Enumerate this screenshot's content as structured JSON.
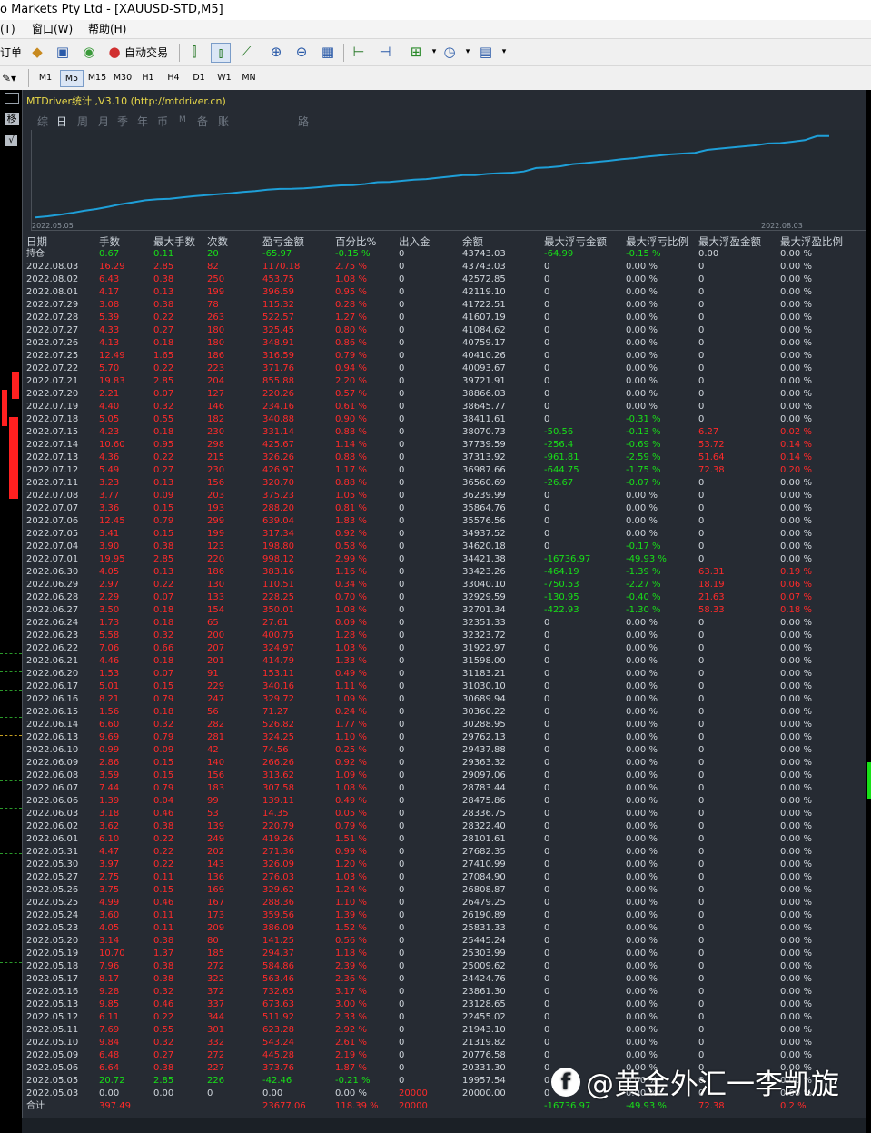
{
  "window": {
    "title": "o Markets Pty Ltd - [XAUUSD-STD,M5]"
  },
  "menu": [
    "(T)",
    "窗口(W)",
    "帮助(H)"
  ],
  "toolbar": {
    "order_label": "订单",
    "auto_trade_label": "自动交易",
    "icons": [
      "bars-icon",
      "candles-icon",
      "line-chart-icon",
      "zoom-in-icon",
      "zoom-out-icon",
      "tile-icon",
      "shift-icon",
      "autoscroll-icon",
      "indicators-icon",
      "clock-icon",
      "templates-icon"
    ]
  },
  "timeframes": [
    "M1",
    "M5",
    "M15",
    "M30",
    "H1",
    "H4",
    "D1",
    "W1",
    "MN"
  ],
  "active_timeframe": "M5",
  "side_labels": [
    "移",
    "√"
  ],
  "panel": {
    "title": "MTDriver统计 ,V3.10 (http://mtdriver.cn)",
    "tabs": [
      "综",
      "日",
      "周",
      "月",
      "季",
      "年",
      "币",
      "M",
      "备",
      "账户",
      "路径"
    ],
    "active_tab": "日"
  },
  "chart_data": {
    "type": "line",
    "x_start_label": "2022.05.05",
    "x_end_label": "2022.08.03",
    "values": [
      20000.0,
      20331.3,
      20776.58,
      21319.82,
      21943.1,
      22455.02,
      23128.65,
      23861.3,
      24424.76,
      25009.62,
      25303.99,
      25445.24,
      25831.33,
      26190.89,
      26479.25,
      26808.87,
      27084.9,
      27410.99,
      27682.35,
      28101.61,
      28322.4,
      28336.75,
      28475.86,
      28783.44,
      29097.06,
      29363.32,
      29437.88,
      29762.13,
      30288.95,
      30360.22,
      30689.94,
      31030.1,
      31183.21,
      31598.0,
      31922.97,
      32323.72,
      32351.33,
      32701.34,
      32929.59,
      33040.1,
      33423.26,
      34421.38,
      34620.18,
      34937.52,
      35576.56,
      35864.76,
      36239.99,
      36560.69,
      36987.66,
      37313.92,
      37739.59,
      38070.73,
      38411.61,
      38645.77,
      38866.03,
      39721.91,
      40093.67,
      40410.26,
      40759.17,
      41084.62,
      41607.19,
      41722.51,
      42119.1,
      42572.85,
      43743.02,
      43743.03
    ],
    "ylim": [
      19000,
      44500
    ],
    "color": "#1e9fd8"
  },
  "table": {
    "headers": [
      "日期",
      "手数",
      "最大手数",
      "次数",
      "盈亏金额",
      "百分比%",
      "出入金",
      "余额",
      "最大浮亏金额",
      "最大浮亏比例",
      "最大浮盈金额",
      "最大浮盈比例"
    ],
    "hold_row": [
      "持仓",
      "0.67",
      "0.11",
      "20",
      "-65.97",
      "-0.15 %",
      "0",
      "43743.03",
      "-64.99",
      "-0.15 %",
      "0.00",
      "0.00 %"
    ],
    "rows": [
      [
        "2022.08.03",
        "16.29",
        "2.85",
        "82",
        "1170.18",
        "2.75 %",
        "0",
        "43743.03",
        "0",
        "0.00 %",
        "0",
        "0.00 %"
      ],
      [
        "2022.08.02",
        "6.43",
        "0.38",
        "250",
        "453.75",
        "1.08 %",
        "0",
        "42572.85",
        "0",
        "0.00 %",
        "0",
        "0.00 %"
      ],
      [
        "2022.08.01",
        "4.17",
        "0.13",
        "199",
        "396.59",
        "0.95 %",
        "0",
        "42119.10",
        "0",
        "0.00 %",
        "0",
        "0.00 %"
      ],
      [
        "2022.07.29",
        "3.08",
        "0.38",
        "78",
        "115.32",
        "0.28 %",
        "0",
        "41722.51",
        "0",
        "0.00 %",
        "0",
        "0.00 %"
      ],
      [
        "2022.07.28",
        "5.39",
        "0.22",
        "263",
        "522.57",
        "1.27 %",
        "0",
        "41607.19",
        "0",
        "0.00 %",
        "0",
        "0.00 %"
      ],
      [
        "2022.07.27",
        "4.33",
        "0.27",
        "180",
        "325.45",
        "0.80 %",
        "0",
        "41084.62",
        "0",
        "0.00 %",
        "0",
        "0.00 %"
      ],
      [
        "2022.07.26",
        "4.13",
        "0.18",
        "180",
        "348.91",
        "0.86 %",
        "0",
        "40759.17",
        "0",
        "0.00 %",
        "0",
        "0.00 %"
      ],
      [
        "2022.07.25",
        "12.49",
        "1.65",
        "186",
        "316.59",
        "0.79 %",
        "0",
        "40410.26",
        "0",
        "0.00 %",
        "0",
        "0.00 %"
      ],
      [
        "2022.07.22",
        "5.70",
        "0.22",
        "223",
        "371.76",
        "0.94 %",
        "0",
        "40093.67",
        "0",
        "0.00 %",
        "0",
        "0.00 %"
      ],
      [
        "2022.07.21",
        "19.83",
        "2.85",
        "204",
        "855.88",
        "2.20 %",
        "0",
        "39721.91",
        "0",
        "0.00 %",
        "0",
        "0.00 %"
      ],
      [
        "2022.07.20",
        "2.21",
        "0.07",
        "127",
        "220.26",
        "0.57 %",
        "0",
        "38866.03",
        "0",
        "0.00 %",
        "0",
        "0.00 %"
      ],
      [
        "2022.07.19",
        "4.40",
        "0.32",
        "146",
        "234.16",
        "0.61 %",
        "0",
        "38645.77",
        "0",
        "0.00 %",
        "0",
        "0.00 %"
      ],
      [
        "2022.07.18",
        "5.05",
        "0.55",
        "182",
        "340.88",
        "0.90 %",
        "0",
        "38411.61",
        "0",
        "-0.31 %",
        "0",
        "0.00 %"
      ],
      [
        "2022.07.15",
        "4.23",
        "0.18",
        "230",
        "331.14",
        "0.88 %",
        "0",
        "38070.73",
        "-50.56",
        "-0.13 %",
        "6.27",
        "0.02 %"
      ],
      [
        "2022.07.14",
        "10.60",
        "0.95",
        "298",
        "425.67",
        "1.14 %",
        "0",
        "37739.59",
        "-256.4",
        "-0.69 %",
        "53.72",
        "0.14 %"
      ],
      [
        "2022.07.13",
        "4.36",
        "0.22",
        "215",
        "326.26",
        "0.88 %",
        "0",
        "37313.92",
        "-961.81",
        "-2.59 %",
        "51.64",
        "0.14 %"
      ],
      [
        "2022.07.12",
        "5.49",
        "0.27",
        "230",
        "426.97",
        "1.17 %",
        "0",
        "36987.66",
        "-644.75",
        "-1.75 %",
        "72.38",
        "0.20 %"
      ],
      [
        "2022.07.11",
        "3.23",
        "0.13",
        "156",
        "320.70",
        "0.88 %",
        "0",
        "36560.69",
        "-26.67",
        "-0.07 %",
        "0",
        "0.00 %"
      ],
      [
        "2022.07.08",
        "3.77",
        "0.09",
        "203",
        "375.23",
        "1.05 %",
        "0",
        "36239.99",
        "0",
        "0.00 %",
        "0",
        "0.00 %"
      ],
      [
        "2022.07.07",
        "3.36",
        "0.15",
        "193",
        "288.20",
        "0.81 %",
        "0",
        "35864.76",
        "0",
        "0.00 %",
        "0",
        "0.00 %"
      ],
      [
        "2022.07.06",
        "12.45",
        "0.79",
        "299",
        "639.04",
        "1.83 %",
        "0",
        "35576.56",
        "0",
        "0.00 %",
        "0",
        "0.00 %"
      ],
      [
        "2022.07.05",
        "3.41",
        "0.15",
        "199",
        "317.34",
        "0.92 %",
        "0",
        "34937.52",
        "0",
        "0.00 %",
        "0",
        "0.00 %"
      ],
      [
        "2022.07.04",
        "3.90",
        "0.38",
        "123",
        "198.80",
        "0.58 %",
        "0",
        "34620.18",
        "0",
        "-0.17 %",
        "0",
        "0.00 %"
      ],
      [
        "2022.07.01",
        "19.95",
        "2.85",
        "220",
        "998.12",
        "2.99 %",
        "0",
        "34421.38",
        "-16736.97",
        "-49.93 %",
        "0",
        "0.00 %"
      ],
      [
        "2022.06.30",
        "4.05",
        "0.13",
        "186",
        "383.16",
        "1.16 %",
        "0",
        "33423.26",
        "-464.19",
        "-1.39 %",
        "63.31",
        "0.19 %"
      ],
      [
        "2022.06.29",
        "2.97",
        "0.22",
        "130",
        "110.51",
        "0.34 %",
        "0",
        "33040.10",
        "-750.53",
        "-2.27 %",
        "18.19",
        "0.06 %"
      ],
      [
        "2022.06.28",
        "2.29",
        "0.07",
        "133",
        "228.25",
        "0.70 %",
        "0",
        "32929.59",
        "-130.95",
        "-0.40 %",
        "21.63",
        "0.07 %"
      ],
      [
        "2022.06.27",
        "3.50",
        "0.18",
        "154",
        "350.01",
        "1.08 %",
        "0",
        "32701.34",
        "-422.93",
        "-1.30 %",
        "58.33",
        "0.18 %"
      ],
      [
        "2022.06.24",
        "1.73",
        "0.18",
        "65",
        "27.61",
        "0.09 %",
        "0",
        "32351.33",
        "0",
        "0.00 %",
        "0",
        "0.00 %"
      ],
      [
        "2022.06.23",
        "5.58",
        "0.32",
        "200",
        "400.75",
        "1.28 %",
        "0",
        "32323.72",
        "0",
        "0.00 %",
        "0",
        "0.00 %"
      ],
      [
        "2022.06.22",
        "7.06",
        "0.66",
        "207",
        "324.97",
        "1.03 %",
        "0",
        "31922.97",
        "0",
        "0.00 %",
        "0",
        "0.00 %"
      ],
      [
        "2022.06.21",
        "4.46",
        "0.18",
        "201",
        "414.79",
        "1.33 %",
        "0",
        "31598.00",
        "0",
        "0.00 %",
        "0",
        "0.00 %"
      ],
      [
        "2022.06.20",
        "1.53",
        "0.07",
        "91",
        "153.11",
        "0.49 %",
        "0",
        "31183.21",
        "0",
        "0.00 %",
        "0",
        "0.00 %"
      ],
      [
        "2022.06.17",
        "5.01",
        "0.15",
        "229",
        "340.16",
        "1.11 %",
        "0",
        "31030.10",
        "0",
        "0.00 %",
        "0",
        "0.00 %"
      ],
      [
        "2022.06.16",
        "8.21",
        "0.79",
        "247",
        "329.72",
        "1.09 %",
        "0",
        "30689.94",
        "0",
        "0.00 %",
        "0",
        "0.00 %"
      ],
      [
        "2022.06.15",
        "1.56",
        "0.18",
        "56",
        "71.27",
        "0.24 %",
        "0",
        "30360.22",
        "0",
        "0.00 %",
        "0",
        "0.00 %"
      ],
      [
        "2022.06.14",
        "6.60",
        "0.32",
        "282",
        "526.82",
        "1.77 %",
        "0",
        "30288.95",
        "0",
        "0.00 %",
        "0",
        "0.00 %"
      ],
      [
        "2022.06.13",
        "9.69",
        "0.79",
        "281",
        "324.25",
        "1.10 %",
        "0",
        "29762.13",
        "0",
        "0.00 %",
        "0",
        "0.00 %"
      ],
      [
        "2022.06.10",
        "0.99",
        "0.09",
        "42",
        "74.56",
        "0.25 %",
        "0",
        "29437.88",
        "0",
        "0.00 %",
        "0",
        "0.00 %"
      ],
      [
        "2022.06.09",
        "2.86",
        "0.15",
        "140",
        "266.26",
        "0.92 %",
        "0",
        "29363.32",
        "0",
        "0.00 %",
        "0",
        "0.00 %"
      ],
      [
        "2022.06.08",
        "3.59",
        "0.15",
        "156",
        "313.62",
        "1.09 %",
        "0",
        "29097.06",
        "0",
        "0.00 %",
        "0",
        "0.00 %"
      ],
      [
        "2022.06.07",
        "7.44",
        "0.79",
        "183",
        "307.58",
        "1.08 %",
        "0",
        "28783.44",
        "0",
        "0.00 %",
        "0",
        "0.00 %"
      ],
      [
        "2022.06.06",
        "1.39",
        "0.04",
        "99",
        "139.11",
        "0.49 %",
        "0",
        "28475.86",
        "0",
        "0.00 %",
        "0",
        "0.00 %"
      ],
      [
        "2022.06.03",
        "3.18",
        "0.46",
        "53",
        "14.35",
        "0.05 %",
        "0",
        "28336.75",
        "0",
        "0.00 %",
        "0",
        "0.00 %"
      ],
      [
        "2022.06.02",
        "3.62",
        "0.38",
        "139",
        "220.79",
        "0.79 %",
        "0",
        "28322.40",
        "0",
        "0.00 %",
        "0",
        "0.00 %"
      ],
      [
        "2022.06.01",
        "6.10",
        "0.22",
        "249",
        "419.26",
        "1.51 %",
        "0",
        "28101.61",
        "0",
        "0.00 %",
        "0",
        "0.00 %"
      ],
      [
        "2022.05.31",
        "4.47",
        "0.22",
        "202",
        "271.36",
        "0.99 %",
        "0",
        "27682.35",
        "0",
        "0.00 %",
        "0",
        "0.00 %"
      ],
      [
        "2022.05.30",
        "3.97",
        "0.22",
        "143",
        "326.09",
        "1.20 %",
        "0",
        "27410.99",
        "0",
        "0.00 %",
        "0",
        "0.00 %"
      ],
      [
        "2022.05.27",
        "2.75",
        "0.11",
        "136",
        "276.03",
        "1.03 %",
        "0",
        "27084.90",
        "0",
        "0.00 %",
        "0",
        "0.00 %"
      ],
      [
        "2022.05.26",
        "3.75",
        "0.15",
        "169",
        "329.62",
        "1.24 %",
        "0",
        "26808.87",
        "0",
        "0.00 %",
        "0",
        "0.00 %"
      ],
      [
        "2022.05.25",
        "4.99",
        "0.46",
        "167",
        "288.36",
        "1.10 %",
        "0",
        "26479.25",
        "0",
        "0.00 %",
        "0",
        "0.00 %"
      ],
      [
        "2022.05.24",
        "3.60",
        "0.11",
        "173",
        "359.56",
        "1.39 %",
        "0",
        "26190.89",
        "0",
        "0.00 %",
        "0",
        "0.00 %"
      ],
      [
        "2022.05.23",
        "4.05",
        "0.11",
        "209",
        "386.09",
        "1.52 %",
        "0",
        "25831.33",
        "0",
        "0.00 %",
        "0",
        "0.00 %"
      ],
      [
        "2022.05.20",
        "3.14",
        "0.38",
        "80",
        "141.25",
        "0.56 %",
        "0",
        "25445.24",
        "0",
        "0.00 %",
        "0",
        "0.00 %"
      ],
      [
        "2022.05.19",
        "10.70",
        "1.37",
        "185",
        "294.37",
        "1.18 %",
        "0",
        "25303.99",
        "0",
        "0.00 %",
        "0",
        "0.00 %"
      ],
      [
        "2022.05.18",
        "7.96",
        "0.38",
        "272",
        "584.86",
        "2.39 %",
        "0",
        "25009.62",
        "0",
        "0.00 %",
        "0",
        "0.00 %"
      ],
      [
        "2022.05.17",
        "8.17",
        "0.38",
        "322",
        "563.46",
        "2.36 %",
        "0",
        "24424.76",
        "0",
        "0.00 %",
        "0",
        "0.00 %"
      ],
      [
        "2022.05.16",
        "9.28",
        "0.32",
        "372",
        "732.65",
        "3.17 %",
        "0",
        "23861.30",
        "0",
        "0.00 %",
        "0",
        "0.00 %"
      ],
      [
        "2022.05.13",
        "9.85",
        "0.46",
        "337",
        "673.63",
        "3.00 %",
        "0",
        "23128.65",
        "0",
        "0.00 %",
        "0",
        "0.00 %"
      ],
      [
        "2022.05.12",
        "6.11",
        "0.22",
        "344",
        "511.92",
        "2.33 %",
        "0",
        "22455.02",
        "0",
        "0.00 %",
        "0",
        "0.00 %"
      ],
      [
        "2022.05.11",
        "7.69",
        "0.55",
        "301",
        "623.28",
        "2.92 %",
        "0",
        "21943.10",
        "0",
        "0.00 %",
        "0",
        "0.00 %"
      ],
      [
        "2022.05.10",
        "9.84",
        "0.32",
        "332",
        "543.24",
        "2.61 %",
        "0",
        "21319.82",
        "0",
        "0.00 %",
        "0",
        "0.00 %"
      ],
      [
        "2022.05.09",
        "6.48",
        "0.27",
        "272",
        "445.28",
        "2.19 %",
        "0",
        "20776.58",
        "0",
        "0.00 %",
        "0",
        "0.00 %"
      ],
      [
        "2022.05.06",
        "6.64",
        "0.38",
        "227",
        "373.76",
        "1.87 %",
        "0",
        "20331.30",
        "0",
        "0.00 %",
        "0",
        "0.00 %"
      ],
      [
        "2022.05.05",
        "20.72",
        "2.85",
        "226",
        "-42.46",
        "-0.21 %",
        "0",
        "19957.54",
        "0",
        "0.00 %",
        "0",
        "0.00 %"
      ],
      [
        "2022.05.03",
        "0.00",
        "0.00",
        "0",
        "0.00",
        "0.00 %",
        "20000",
        "20000.00",
        "0",
        "0.00 %",
        "0",
        "0.00 %"
      ]
    ],
    "total_row": [
      "合计",
      "397.49",
      "",
      "",
      "23677.06",
      "118.39 %",
      "20000",
      "",
      "-16736.97",
      "-49.93 %",
      "72.38",
      "0.2 %"
    ]
  },
  "watermark": {
    "logo_glyph": "f",
    "text": "@黄金外汇一李凯旋"
  },
  "colors": {
    "positive": "#ff2a2a",
    "negative": "#18e018",
    "neutral": "#d0d6dc",
    "equity_line": "#1e9fd8",
    "title": "#e8d84a"
  }
}
